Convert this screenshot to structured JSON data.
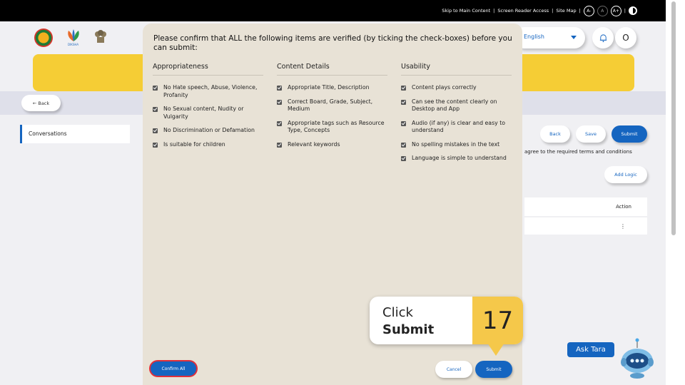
{
  "topbar": {
    "skip_link": "Skip to Main Content",
    "reader_link": "Screen Reader Access",
    "sitemap_link": "Site Map",
    "separator": "|",
    "font_decrease": "A-",
    "font_normal": "A",
    "font_increase": "A+"
  },
  "header": {
    "logo_text": "DIKSHA",
    "language": "English",
    "avatar_initial": "O"
  },
  "subbar": {
    "back_label": "← Back"
  },
  "sidebar": {
    "item_label": "Conversations"
  },
  "editor": {
    "back_label": "Back",
    "save_label": "Save",
    "submit_label": "Submit",
    "terms_text": "agree to the required terms and conditions",
    "add_logic_label": "Add Logic",
    "table_action_header": "Action",
    "row_menu": "⋮"
  },
  "modal": {
    "title": "Please confirm that ALL the following items are verified (by ticking the check-boxes) before you can submit:",
    "columns": [
      {
        "heading": "Appropriateness",
        "items": [
          "No Hate speech, Abuse, Violence, Profanity",
          "No Sexual content, Nudity or Vulgarity",
          "No Discrimination or Defamation",
          "Is suitable for children"
        ]
      },
      {
        "heading": "Content Details",
        "items": [
          "Appropriate Title, Description",
          "Correct Board, Grade, Subject, Medium",
          "Appropriate tags such as Resource Type, Concepts",
          "Relevant keywords"
        ]
      },
      {
        "heading": "Usability",
        "items": [
          "Content plays correctly",
          "Can see the content clearly on Desktop and App",
          "Audio (if any) is clear and easy to understand",
          "No spelling mistakes in the text",
          "Language is simple to understand"
        ]
      }
    ],
    "confirm_all_label": "Confirm All",
    "cancel_label": "Cancel",
    "submit_label": "Submit"
  },
  "callout": {
    "line1": "Click",
    "line2": "Submit",
    "step_number": "17",
    "color": "#f5c84a"
  },
  "assistant": {
    "label": "Ask Tara"
  },
  "colors": {
    "primary": "#1565c0",
    "banner": "#f5cd35",
    "confirm_border": "#e0303a"
  }
}
